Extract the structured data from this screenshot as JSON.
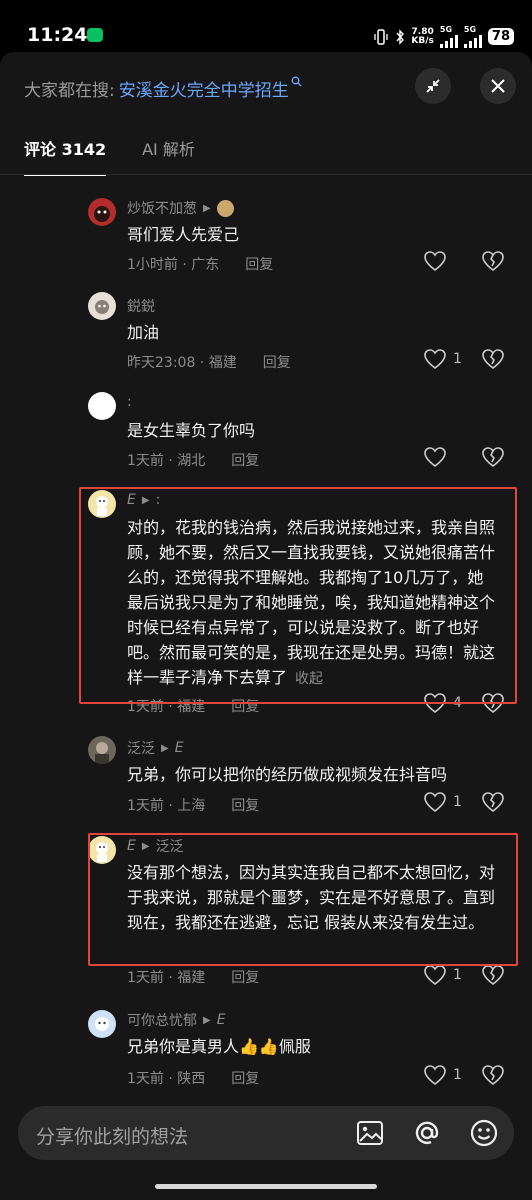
{
  "status_bar": {
    "time": "11:24",
    "speed_value": "7.80",
    "speed_unit": "KB/s",
    "net1": "5G",
    "net2": "5G",
    "battery": "78"
  },
  "search": {
    "prefix": "大家都在搜:",
    "query": "安溪金火完全中学招生"
  },
  "tabs": [
    {
      "label": "评论 3142",
      "active": true
    },
    {
      "label": "AI 解析",
      "active": false
    }
  ],
  "comments": [
    {
      "name": "炒饭不加葱",
      "content": "哥们爱人先爱己",
      "time": "1小时前",
      "location": "广东",
      "reply": "回复",
      "likes": ""
    },
    {
      "name": "鋭鋭",
      "content": "加油",
      "time": "昨天23:08",
      "location": "福建",
      "reply": "回复",
      "likes": "1"
    },
    {
      "name": ":",
      "content": "是女生辜负了你吗",
      "time": "1天前",
      "location": "湖北",
      "reply": "回复",
      "likes": ""
    },
    {
      "name": "E",
      "reply_to": ":",
      "content": "对的，花我的钱治病，然后我说接她过来，我亲自照顾，她不要，然后又一直找我要钱，又说她很痛苦什么的，还觉得我不理解她。我都掏了10几万了，她最后说我只是为了和她睡觉，唉，我知道她精神这个时候已经有点异常了，可以说是没救了。断了也好吧。然而最可笑的是，我现在还是处男。玛德！就这样一辈子清净下去算了",
      "collapse": "收起",
      "time": "1天前",
      "location": "福建",
      "reply": "回复",
      "likes": "4"
    },
    {
      "name": "泛泛",
      "reply_to": "E",
      "content": "兄弟，你可以把你的经历做成视频发在抖音吗",
      "time": "1天前",
      "location": "上海",
      "reply": "回复",
      "likes": "1"
    },
    {
      "name": "E",
      "reply_to": "泛泛",
      "content": "没有那个想法，因为其实连我自己都不太想回忆，对于我来说，那就是个噩梦，实在是不好意思了。直到现在，我都还在逃避，忘记 假装从来没有发生过。",
      "time": "1天前",
      "location": "福建",
      "reply": "回复",
      "likes": "1"
    },
    {
      "name": "可你总忧郁",
      "reply_to": "E",
      "content": "兄弟你是真男人👍👍佩服",
      "time": "1天前",
      "location": "陕西",
      "reply": "回复",
      "likes": "1"
    }
  ],
  "input": {
    "placeholder": "分享你此刻的想法"
  },
  "colors": {
    "accent_link": "#6aa8ff",
    "highlight_box": "#e2453c",
    "sheet_bg": "#161616"
  },
  "icons": [
    "search-icon",
    "collapse-icon",
    "close-icon",
    "heart-icon",
    "broken-heart-icon",
    "image-icon",
    "at-icon",
    "emoji-icon"
  ]
}
